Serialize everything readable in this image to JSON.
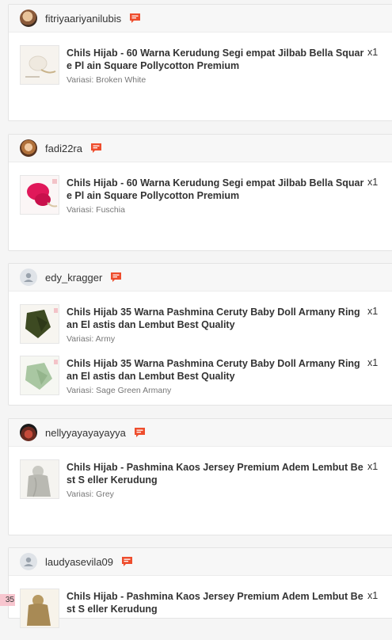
{
  "orders": [
    {
      "username": "fitriyaariyanilubis",
      "items": [
        {
          "title": "Chils Hijab - 60 Warna Kerudung Segi empat Jilbab Bella Square Pl ain Square Pollycotton Premium",
          "qty": "x1",
          "variant": "Variasi: Broken White",
          "color": "#efe9df"
        }
      ]
    },
    {
      "username": "fadi22ra",
      "items": [
        {
          "title": "Chils Hijab - 60 Warna Kerudung Segi empat Jilbab Bella Square Pl ain Square Pollycotton Premium",
          "qty": "x1",
          "variant": "Variasi: Fuschia",
          "color": "#e0185a"
        }
      ]
    },
    {
      "username": "edy_kragger",
      "items": [
        {
          "title": "Chils Hijab 35 Warna Pashmina Ceruty Baby Doll Armany Ringan El astis dan Lembut Best Quality",
          "qty": "x1",
          "variant": "Variasi: Army",
          "color": "#3d4a22"
        },
        {
          "title": "Chils Hijab 35 Warna Pashmina Ceruty Baby Doll Armany Ringan El astis dan Lembut Best Quality",
          "qty": "x1",
          "variant": "Variasi: Sage Green Armany",
          "color": "#a9c7a2"
        }
      ]
    },
    {
      "username": "nellyyayayayayya",
      "items": [
        {
          "title": "Chils Hijab - Pashmina Kaos Jersey Premium Adem Lembut Best S eller Kerudung",
          "qty": "x1",
          "variant": "Variasi: Grey",
          "color": "#b9b9b2"
        }
      ]
    },
    {
      "username": "laudyasevila09",
      "items": [
        {
          "title": "Chils Hijab - Pashmina Kaos Jersey Premium Adem Lembut Best S eller Kerudung",
          "qty": "x1",
          "variant": "",
          "color": "#a88a55"
        }
      ]
    }
  ],
  "badge": "35",
  "colors": {
    "chat_icon": "#ee4d2d",
    "badge_bg": "#f7c6cf"
  }
}
